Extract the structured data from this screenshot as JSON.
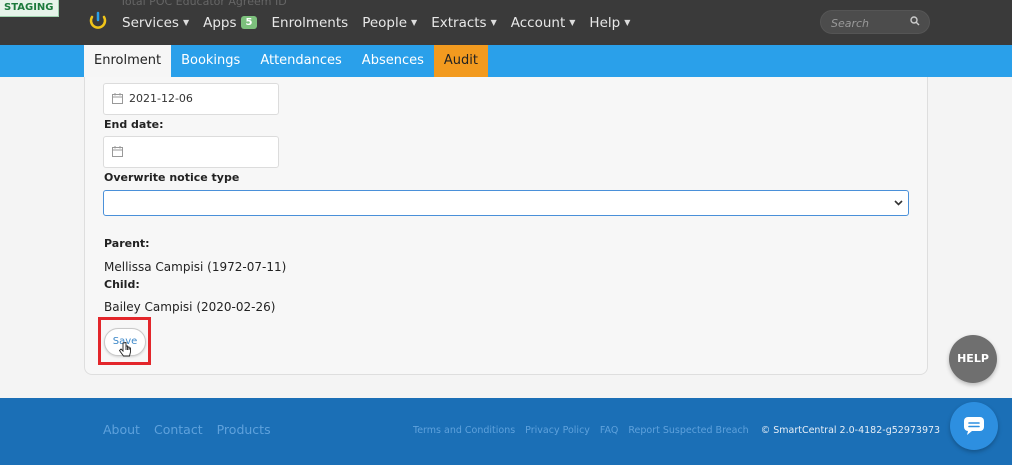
{
  "env_badge": "STAGING",
  "ghost_header": "Total POC Educator Agreem ID",
  "nav": {
    "items": [
      {
        "label": "Services",
        "dropdown": true
      },
      {
        "label": "Apps",
        "badge": "5"
      },
      {
        "label": "Enrolments"
      },
      {
        "label": "People",
        "dropdown": true
      },
      {
        "label": "Extracts",
        "dropdown": true
      },
      {
        "label": "Account",
        "dropdown": true
      },
      {
        "label": "Help",
        "dropdown": true
      }
    ],
    "search_placeholder": "Search"
  },
  "tabs": [
    "Enrolment",
    "Bookings",
    "Attendances",
    "Absences",
    "Audit"
  ],
  "form": {
    "start_date_value": "2021-12-06",
    "end_date_label": "End date:",
    "end_date_value": "",
    "notice_label": "Overwrite notice type",
    "notice_value": "",
    "parent_label": "Parent:",
    "parent_value": "Mellissa Campisi (1972-07-11)",
    "child_label": "Child:",
    "child_value": "Bailey Campisi (2020-02-26)",
    "save_label": "Save"
  },
  "footer": {
    "left_links": [
      "About",
      "Contact",
      "Products"
    ],
    "right_links": [
      "Terms and Conditions",
      "Privacy Policy",
      "FAQ",
      "Report Suspected Breach"
    ],
    "copyright": "© SmartCentral 2.0-4182-g52973973"
  },
  "help_button": "HELP",
  "colors": {
    "nav_bg": "#3a3a3a",
    "tab_bar": "#2aa0ea",
    "audit_tab": "#f29a1f",
    "footer_bg": "#1b6fb6",
    "highlight": "#e3262b"
  }
}
